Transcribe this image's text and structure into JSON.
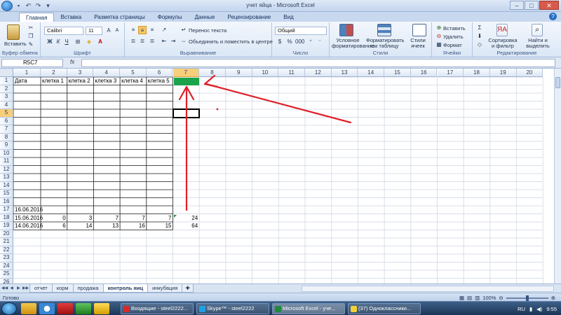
{
  "window": {
    "title": "учет яйца - Microsoft Excel"
  },
  "ribbon_tabs": [
    "Главная",
    "Вставка",
    "Разметка страницы",
    "Формулы",
    "Данные",
    "Рецензирование",
    "Вид"
  ],
  "ribbon": {
    "clipboard": {
      "label": "Буфер обмена",
      "paste": "Вставить"
    },
    "font": {
      "label": "Шрифт",
      "name": "Calibri",
      "size": "11",
      "bold": "Ж",
      "italic": "К",
      "underline": "Ч"
    },
    "alignment": {
      "label": "Выравнивание",
      "wrap": "Перенос текста",
      "merge": "Объединить и поместить в центре"
    },
    "number": {
      "label": "Число",
      "format": "Общий"
    },
    "styles": {
      "label": "Стили",
      "conditional": "Условное форматирование",
      "as_table": "Форматировать как таблицу",
      "cell_styles": "Стили ячеек"
    },
    "cells": {
      "label": "Ячейки",
      "insert": "Вставить",
      "delete": "Удалить",
      "format": "Формат"
    },
    "editing": {
      "label": "Редактирование",
      "sort": "Сортировка и фильтр",
      "find": "Найти и выделить"
    }
  },
  "formula_bar": {
    "name_box": "R5C7",
    "fx": "fx",
    "formula": ""
  },
  "columns": [
    "1",
    "2",
    "3",
    "4",
    "5",
    "6",
    "7",
    "8",
    "9",
    "10",
    "11",
    "12",
    "13",
    "14",
    "15",
    "16",
    "17",
    "18",
    "19",
    "20"
  ],
  "rows": [
    "1",
    "2",
    "3",
    "4",
    "5",
    "6",
    "7",
    "8",
    "9",
    "10",
    "11",
    "12",
    "13",
    "14",
    "15",
    "16",
    "17",
    "18",
    "19",
    "20",
    "21",
    "22",
    "23",
    "24",
    "25",
    "26"
  ],
  "header_row": [
    "Дата",
    "клетка 1",
    "клетка 2",
    "клетка 3",
    "клетка 4",
    "клетка 5"
  ],
  "data_rows": [
    {
      "row": 17,
      "date": "16.06.2016",
      "values": [
        "",
        "",
        "",
        "",
        ""
      ],
      "total": ""
    },
    {
      "row": 18,
      "date": "15.06.2016",
      "values": [
        "0",
        "3",
        "7",
        "7",
        "7"
      ],
      "total": "24"
    },
    {
      "row": 19,
      "date": "14.06.2016",
      "values": [
        "6",
        "14",
        "13",
        "16",
        "15"
      ],
      "total": "64"
    }
  ],
  "sheet_tabs": [
    "отчет",
    "корм",
    "продажа",
    "контроль яиц",
    "инкубация"
  ],
  "active_sheet": "контроль яиц",
  "status": {
    "ready": "Готово",
    "zoom": "100%"
  },
  "taskbar": {
    "tasks": [
      "Входящие - steel2222...",
      "Skype™ - steel2222",
      "Microsoft Excel - уче...",
      "(37) Одноклассники..."
    ],
    "lang": "RU",
    "clock": "9:55"
  },
  "colors": {
    "selected_cell": "#1aa34a",
    "annotation_arrow": "#e0202a",
    "header_highlight": "#f7cf7b"
  }
}
